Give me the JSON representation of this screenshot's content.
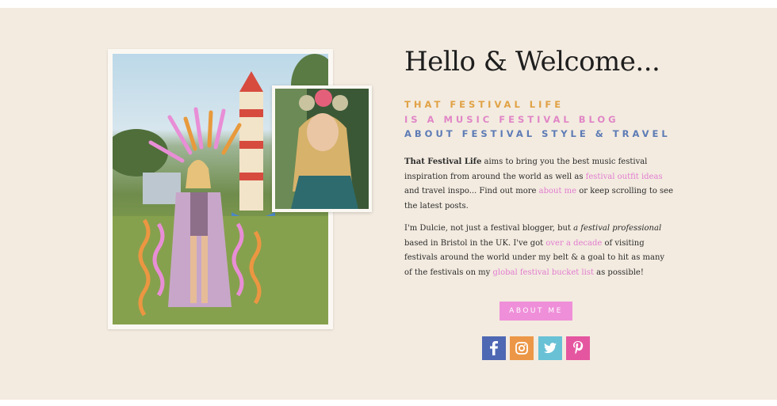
{
  "header": {
    "title": "Hello & Welcome..."
  },
  "taglines": [
    "THAT FESTIVAL LIFE",
    "IS A MUSIC FESTIVAL BLOG",
    "ABOUT FESTIVAL STYLE & TRAVEL"
  ],
  "intro": {
    "brand": "That Festival Life",
    "text1": " aims to bring you the best music festival inspiration from around the world as well as ",
    "link1": "festival outfit ideas",
    "text2": " and travel inspo...  Find out more ",
    "link2": "about me",
    "text3": " or keep scrolling to see the latest posts."
  },
  "bio": {
    "text1": "I'm Dulcie, not just a festival blogger, but ",
    "em": "a festival professional",
    "text2": " based in Bristol in the UK. I've got ",
    "link1": "over a decade",
    "text3": " of visiting festivals around the world under my belt & a goal to hit as many of the festivals on my ",
    "link2": "global festival bucket list",
    "text4": " as possible!"
  },
  "cta": {
    "about_label": "ABOUT ME"
  },
  "social": [
    {
      "name": "facebook-icon",
      "color": "#4f68b4"
    },
    {
      "name": "instagram-icon",
      "color": "#ec9747"
    },
    {
      "name": "twitter-icon",
      "color": "#69c1d6"
    },
    {
      "name": "pinterest-icon",
      "color": "#e556a0"
    }
  ],
  "colors": {
    "background": "#f3ebe0",
    "accent_orange": "#e0a245",
    "accent_pink": "#e186c6",
    "accent_blue": "#5d7bb5",
    "link_pink": "#e27ccf",
    "button_pink": "#ef8fd9"
  }
}
